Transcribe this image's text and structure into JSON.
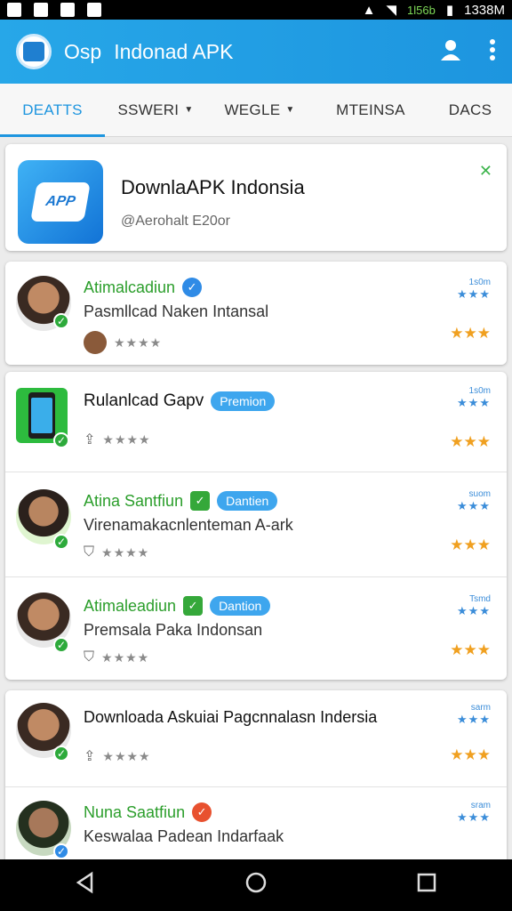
{
  "status_bar": {
    "left_icons": [
      "image-icon",
      "mail-icon",
      "card-icon",
      "clipboard-icon"
    ],
    "speed": "1l56b",
    "time": "1338M"
  },
  "app_bar": {
    "title_prefix": "Osp",
    "title": "Indonad APK"
  },
  "tabs": [
    {
      "label": "DEATTS",
      "active": true
    },
    {
      "label": "SSWERI",
      "caret": true
    },
    {
      "label": "WEGLE",
      "caret": true
    },
    {
      "label": "MTEINSA"
    },
    {
      "label": "DACS"
    }
  ],
  "featured": {
    "icon_label": "APP",
    "title": "DownlaAPK Indonsia",
    "subtitle": "@Aerohalt E20or"
  },
  "list": [
    {
      "title": "Atimalcadiun",
      "badge": "",
      "desc": "Pasmllcad Naken Intansal",
      "right_small": "1s0m"
    },
    {
      "title": "Rulanlcad Gapv",
      "badge": "Premion",
      "desc": "",
      "right_small": "1s0m"
    },
    {
      "title": "Atina Santfiun",
      "badge": "Dantien",
      "desc": "Virenamakacnlenteman A-ark",
      "right_small": "suom"
    },
    {
      "title": "Atimaleadiun",
      "badge": "Dantion",
      "desc": "Premsala Paka Indonsan",
      "right_small": "Tsmd"
    },
    {
      "title": "Downloada Askuiai Pagcnnalasn Indersia",
      "badge": "",
      "desc": "",
      "right_small": "sarm"
    },
    {
      "title": "Nuna Saatfiun",
      "badge": "",
      "desc": "Keswalaa Padean Indarfaak",
      "right_small": "sram"
    }
  ],
  "colors": {
    "primary": "#1d95df",
    "accent_green": "#2b9e2b",
    "star_orange": "#f0a020"
  }
}
